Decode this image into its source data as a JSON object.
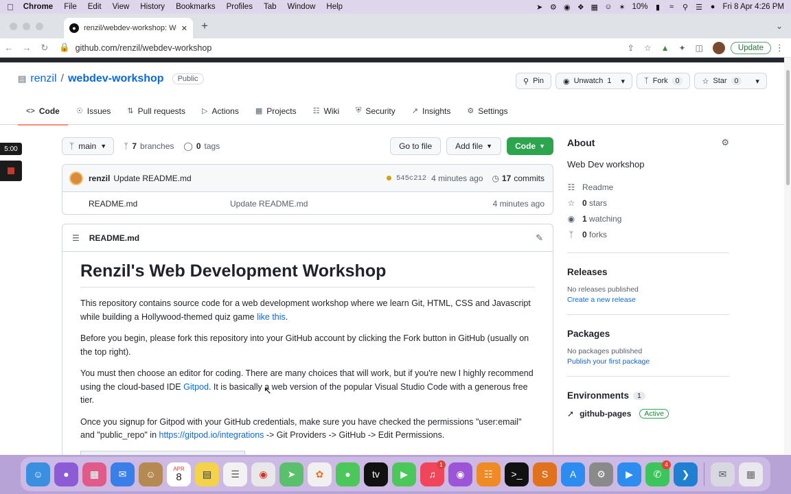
{
  "menubar": {
    "app": "Chrome",
    "items": [
      "File",
      "Edit",
      "View",
      "History",
      "Bookmarks",
      "Profiles",
      "Tab",
      "Window",
      "Help"
    ],
    "battery": "10%",
    "clock": "Fri 8 Apr  4:26 PM"
  },
  "browser": {
    "tab_title": "renzil/webdev-workshop: Web",
    "url": "github.com/renzil/webdev-workshop",
    "update_label": "Update"
  },
  "repo": {
    "owner": "renzil",
    "separator": "/",
    "name": "webdev-workshop",
    "visibility": "Public",
    "pin_label": "Pin",
    "unwatch_label": "Unwatch",
    "watch_count": "1",
    "fork_label": "Fork",
    "fork_count": "0",
    "star_label": "Star",
    "star_count": "0"
  },
  "nav": {
    "code": "Code",
    "issues": "Issues",
    "pulls": "Pull requests",
    "actions": "Actions",
    "projects": "Projects",
    "wiki": "Wiki",
    "security": "Security",
    "insights": "Insights",
    "settings": "Settings"
  },
  "recorder": {
    "time": "5:00"
  },
  "branchbar": {
    "branch": "main",
    "branches_count": "7",
    "branches_label": "branches",
    "tags_count": "0",
    "tags_label": "tags",
    "goto_file": "Go to file",
    "add_file": "Add file",
    "code": "Code"
  },
  "latest_commit": {
    "author": "renzil",
    "message": "Update README.md",
    "sha": "545c212",
    "time": "4 minutes ago",
    "commits_count": "17",
    "commits_label": "commits"
  },
  "files": [
    {
      "name": "README.md",
      "message": "Update README.md",
      "time": "4 minutes ago"
    }
  ],
  "readme": {
    "filename": "README.md",
    "title": "Renzil's Web Development Workshop",
    "p1_text": "This repository contains source code for a web development workshop where we learn Git, HTML, CSS and Javascript while building a Hollywood-themed quiz game ",
    "p1_link": "like this",
    "p1_end": ".",
    "p2": "Before you begin, please fork this repository into your GitHub account by clicking the Fork button in GitHub (usually on the top right).",
    "p3_text": "You must then choose an editor for coding. There are many choices that will work, but if you're new I highly recommend using the cloud-based IDE ",
    "p3_link": "Gitpod",
    "p3_end": ". It is basically a web version of the popular Visual Studio Code with a generous free tier.",
    "p4_text": "Once you signup for Gitpod with your GitHub credentials, make sure you have checked the permissions \"user:email\" and \"public_repo\" in ",
    "p4_link": "https://gitpod.io/integrations",
    "p4_end": " -> Git Providers -> GitHub -> Edit Permissions."
  },
  "about": {
    "heading": "About",
    "description": "Web Dev workshop",
    "readme": "Readme",
    "stars_count": "0",
    "stars_label": "stars",
    "watching_count": "1",
    "watching_label": "watching",
    "forks_count": "0",
    "forks_label": "forks"
  },
  "releases": {
    "heading": "Releases",
    "none": "No releases published",
    "create": "Create a new release"
  },
  "packages": {
    "heading": "Packages",
    "none": "No packages published",
    "publish": "Publish your first package"
  },
  "environments": {
    "heading": "Environments",
    "count": "1",
    "name": "github-pages",
    "status": "Active"
  },
  "dock": {
    "calendar_month": "APR",
    "calendar_day": "8",
    "badge_music": "1",
    "badge_whatsapp": "4"
  },
  "colors": {
    "accent_link": "#0969da",
    "primary_green": "#2da44e",
    "tab_underline": "#fd8c73"
  }
}
